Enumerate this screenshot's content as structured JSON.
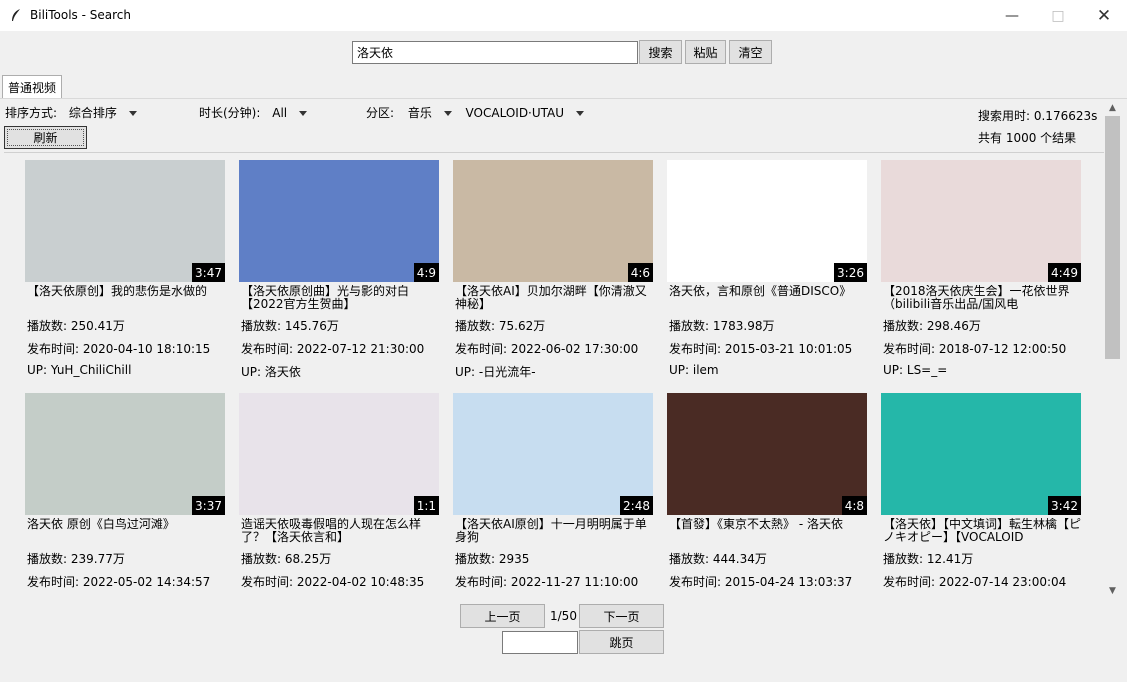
{
  "window": {
    "title": "BiliTools - Search",
    "min_icon": "minimize-icon",
    "max_icon": "maximize-icon",
    "close_icon": "close-icon"
  },
  "search": {
    "value": "洛天依",
    "search_label": "搜索",
    "paste_label": "粘贴",
    "clear_label": "清空"
  },
  "tabs": [
    {
      "label": "普通视频"
    }
  ],
  "filters": {
    "sort_label": "排序方式:",
    "sort_value": "综合排序",
    "duration_label": "时长(分钟):",
    "duration_value": "All",
    "zone_label": "分区:",
    "zone_value": "音乐",
    "subzone_value": "VOCALOID·UTAU",
    "refresh_label": "刷新"
  },
  "stats": {
    "time": "搜索用时: 0.176623s",
    "count": "共有 1000 个结果"
  },
  "results": [
    {
      "duration": "3:47",
      "title": "【洛天依原创】我的悲伤是水做的",
      "plays": "播放数: 250.41万",
      "date": "发布时间: 2020-04-10 18:10:15",
      "up": "UP: YuH_ChiliChill",
      "thumb_color": "#c9cfd0"
    },
    {
      "duration": "4:9",
      "title": "【洛天依原创曲】光与影的对白【2022官方生贺曲】",
      "plays": "播放数: 145.76万",
      "date": "发布时间: 2022-07-12 21:30:00",
      "up": "UP: 洛天依",
      "thumb_color": "#5f7fc6"
    },
    {
      "duration": "4:6",
      "title": "【洛天依AI】贝加尔湖畔【你清澈又神秘】",
      "plays": "播放数: 75.62万",
      "date": "发布时间: 2022-06-02 17:30:00",
      "up": "UP: -日光流年-",
      "thumb_color": "#c9b9a4"
    },
    {
      "duration": "3:26",
      "title": "洛天依，言和原创《普通DISCO》",
      "plays": "播放数: 1783.98万",
      "date": "发布时间: 2015-03-21 10:01:05",
      "up": "UP: ilem",
      "thumb_color": "#ffffff"
    },
    {
      "duration": "4:49",
      "title": "【2018洛天依庆生会】一花依世界（bilibili音乐出品/国风电",
      "plays": "播放数: 298.46万",
      "date": "发布时间: 2018-07-12 12:00:50",
      "up": "UP: LS=_=",
      "thumb_color": "#e9dada"
    },
    {
      "duration": "3:37",
      "title": "洛天依 原创《白鸟过河滩》",
      "plays": "播放数: 239.77万",
      "date": "发布时间: 2022-05-02 14:34:57",
      "up": "UP: ...",
      "thumb_color": "#c4cdc8"
    },
    {
      "duration": "1:1",
      "title": "造谣天依吸毒假唱的人现在怎么样了？【洛天依言和】",
      "plays": "播放数: 68.25万",
      "date": "发布时间: 2022-04-02 10:48:35",
      "up": "UP: ...",
      "thumb_color": "#e8e3ea"
    },
    {
      "duration": "2:48",
      "title": "【洛天依AI原创】十一月明明属于单身狗",
      "plays": "播放数: 2935",
      "date": "发布时间: 2022-11-27 11:10:00",
      "up": "UP: ...",
      "thumb_color": "#c7ddf0"
    },
    {
      "duration": "4:8",
      "title": "【首發】《東京不太熱》 - 洛天依",
      "plays": "播放数: 444.34万",
      "date": "发布时间: 2015-04-24 13:03:37",
      "up": "UP: ...",
      "thumb_color": "#4a2b24"
    },
    {
      "duration": "3:42",
      "title": "【洛天依】【中文填词】転生林檎【ピノキオピー】【VOCALOID",
      "plays": "播放数: 12.41万",
      "date": "发布时间: 2022-07-14 23:00:04",
      "up": "UP: ...",
      "thumb_color": "#25b7a9"
    }
  ],
  "pager": {
    "prev_label": "上一页",
    "next_label": "下一页",
    "info": "1/50",
    "jump_label": "跳页",
    "jump_value": ""
  }
}
